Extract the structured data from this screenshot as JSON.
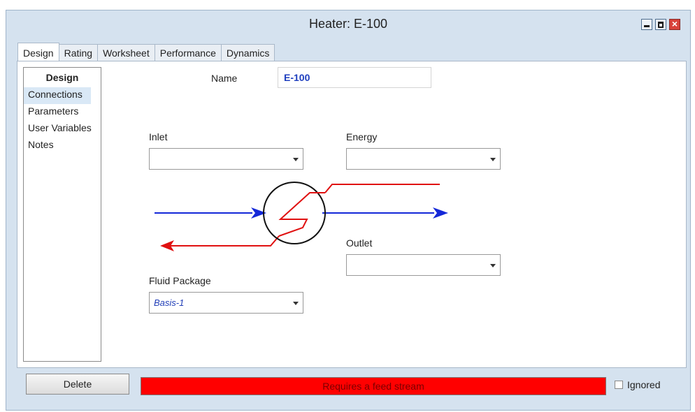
{
  "window": {
    "title": "Heater: E-100"
  },
  "tabs": [
    {
      "label": "Design",
      "active": true
    },
    {
      "label": "Rating",
      "active": false
    },
    {
      "label": "Worksheet",
      "active": false
    },
    {
      "label": "Performance",
      "active": false
    },
    {
      "label": "Dynamics",
      "active": false
    }
  ],
  "sidenav": {
    "header": "Design",
    "items": [
      {
        "label": "Connections",
        "selected": true
      },
      {
        "label": "Parameters"
      },
      {
        "label": "User Variables"
      },
      {
        "label": "Notes"
      }
    ]
  },
  "form": {
    "name_label": "Name",
    "name_value": "E-100",
    "inlet_label": "Inlet",
    "inlet_value": "",
    "energy_label": "Energy",
    "energy_value": "",
    "outlet_label": "Outlet",
    "outlet_value": "",
    "fluid_package_label": "Fluid Package",
    "fluid_package_value": "Basis-1"
  },
  "bottom": {
    "delete_label": "Delete",
    "status_text": "Requires a feed stream",
    "ignored_label": "Ignored",
    "ignored_checked": false
  },
  "colors": {
    "status_bg": "#ff0000",
    "status_text": "#7b0000",
    "process_stream": "#1428d8",
    "energy_stream": "#e01010",
    "window_frame": "#d5e2ef"
  },
  "icons": {
    "minimize": "minimize-icon",
    "maximize": "maximize-icon",
    "close": "close-icon",
    "dropdown": "chevron-down-icon",
    "heater": "heater-icon"
  }
}
